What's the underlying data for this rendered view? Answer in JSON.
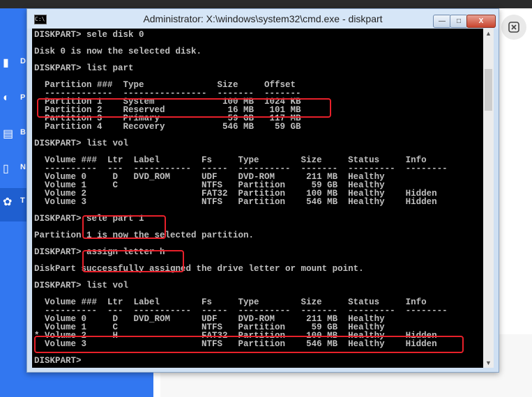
{
  "window": {
    "title": "Administrator: X:\\windows\\system32\\cmd.exe - diskpart",
    "icon_text": "C:\\",
    "minimize": "—",
    "maximize": "□",
    "close": "X"
  },
  "sidebar": {
    "items": [
      {
        "initial": "D",
        "icon": "drive-icon"
      },
      {
        "initial": "P",
        "icon": "partition-icon"
      },
      {
        "initial": "B",
        "icon": "backup-icon"
      },
      {
        "initial": "N",
        "icon": "new-icon"
      },
      {
        "initial": "T",
        "icon": "tools-icon"
      }
    ]
  },
  "floating_button": {
    "icon": "close-icon",
    "glyph": "⊠"
  },
  "console": {
    "lines": [
      "DISKPART> sele disk 0",
      "",
      "Disk 0 is now the selected disk.",
      "",
      "DISKPART> list part",
      "",
      "  Partition ###  Type              Size     Offset",
      "  -------------  ----------------  -------  -------",
      "  Partition 1    System             100 MB  1024 KB",
      "  Partition 2    Reserved            16 MB   101 MB",
      "  Partition 3    Primary             59 GB   117 MB",
      "  Partition 4    Recovery           546 MB    59 GB",
      "",
      "DISKPART> list vol",
      "",
      "  Volume ###  Ltr  Label        Fs     Type        Size     Status     Info",
      "  ----------  ---  -----------  -----  ----------  -------  ---------  --------",
      "  Volume 0     D   DVD_ROM      UDF    DVD-ROM      211 MB  Healthy",
      "  Volume 1     C                NTFS   Partition     59 GB  Healthy",
      "  Volume 2                      FAT32  Partition    100 MB  Healthy    Hidden",
      "  Volume 3                      NTFS   Partition    546 MB  Healthy    Hidden",
      "",
      "DISKPART> sele part 1",
      "",
      "Partition 1 is now the selected partition.",
      "",
      "DISKPART> assign letter h",
      "",
      "DiskPart successfully assigned the drive letter or mount point.",
      "",
      "DISKPART> list vol",
      "",
      "  Volume ###  Ltr  Label        Fs     Type        Size     Status     Info",
      "  ----------  ---  -----------  -----  ----------  -------  ---------  --------",
      "  Volume 0     D   DVD_ROM      UDF    DVD-ROM      211 MB  Healthy",
      "  Volume 1     C                NTFS   Partition     59 GB  Healthy",
      "* Volume 2     H                FAT32  Partition    100 MB  Healthy    Hidden",
      "  Volume 3                      NTFS   Partition    546 MB  Healthy    Hidden",
      "",
      "DISKPART> "
    ]
  },
  "colors": {
    "sidebar": "#3277f0",
    "console_bg": "#000000",
    "console_text": "#c0c0c0",
    "highlight": "#e8202a"
  }
}
